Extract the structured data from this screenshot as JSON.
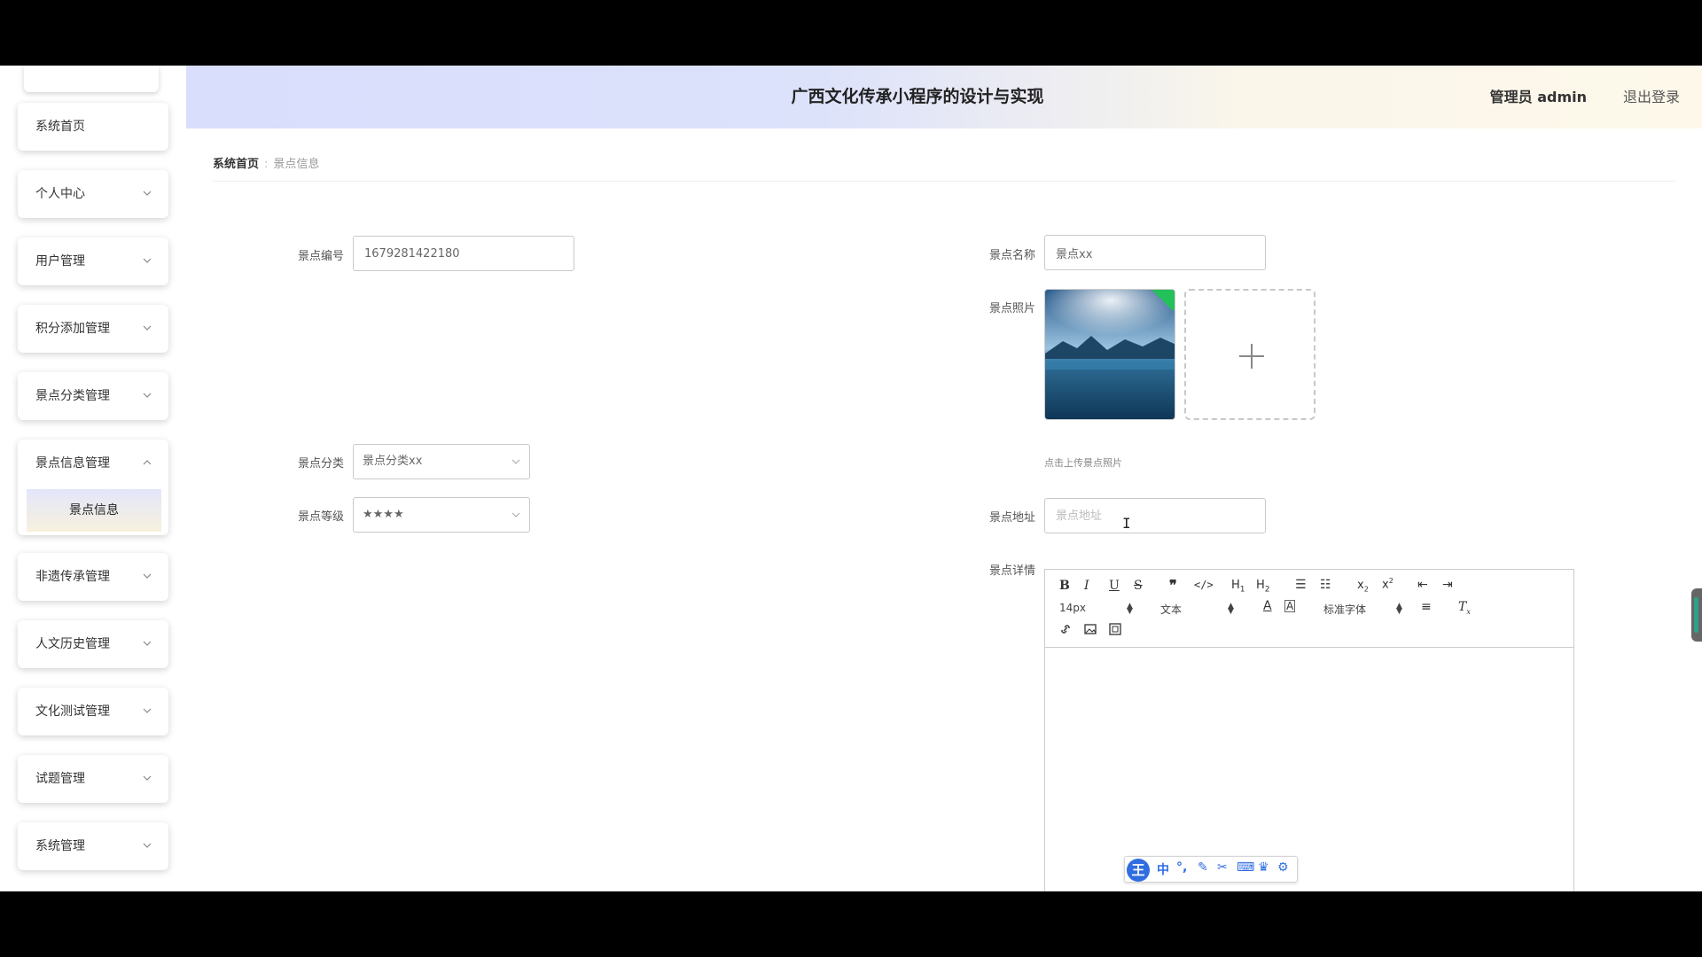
{
  "header": {
    "title": "广西文化传承小程序的设计与实现",
    "admin": "管理员 admin",
    "logout": "退出登录"
  },
  "sidebar": {
    "items": [
      {
        "label": "系统首页"
      },
      {
        "label": "个人中心"
      },
      {
        "label": "用户管理"
      },
      {
        "label": "积分添加管理"
      },
      {
        "label": "景点分类管理"
      },
      {
        "label": "景点信息管理",
        "submenu": "景点信息"
      },
      {
        "label": "非遗传承管理"
      },
      {
        "label": "人文历史管理"
      },
      {
        "label": "文化测试管理"
      },
      {
        "label": "试题管理"
      },
      {
        "label": "系统管理"
      }
    ]
  },
  "breadcrumb": {
    "home": "系统首页",
    "separator": ":",
    "current": "景点信息"
  },
  "form": {
    "code_label": "景点编号",
    "code_value": "1679281422180",
    "name_label": "景点名称",
    "name_value": "景点xx",
    "photo_label": "景点照片",
    "photo_hint": "点击上传景点照片",
    "category_label": "景点分类",
    "category_value": "景点分类xx",
    "level_label": "景点等级",
    "level_value": "★★★★",
    "address_label": "景点地址",
    "address_placeholder": "景点地址",
    "detail_label": "景点详情"
  },
  "editor": {
    "font_size": "14px",
    "header_select": "文本",
    "font_family": "标准字体"
  },
  "ime": {
    "logo": "王",
    "lang": "中"
  },
  "colors": {
    "header_gradient_start": "#d8defc",
    "header_gradient_end": "#fdf8ea",
    "ime_blue": "#2f6de1",
    "photo_corner_green": "#24c15b"
  }
}
